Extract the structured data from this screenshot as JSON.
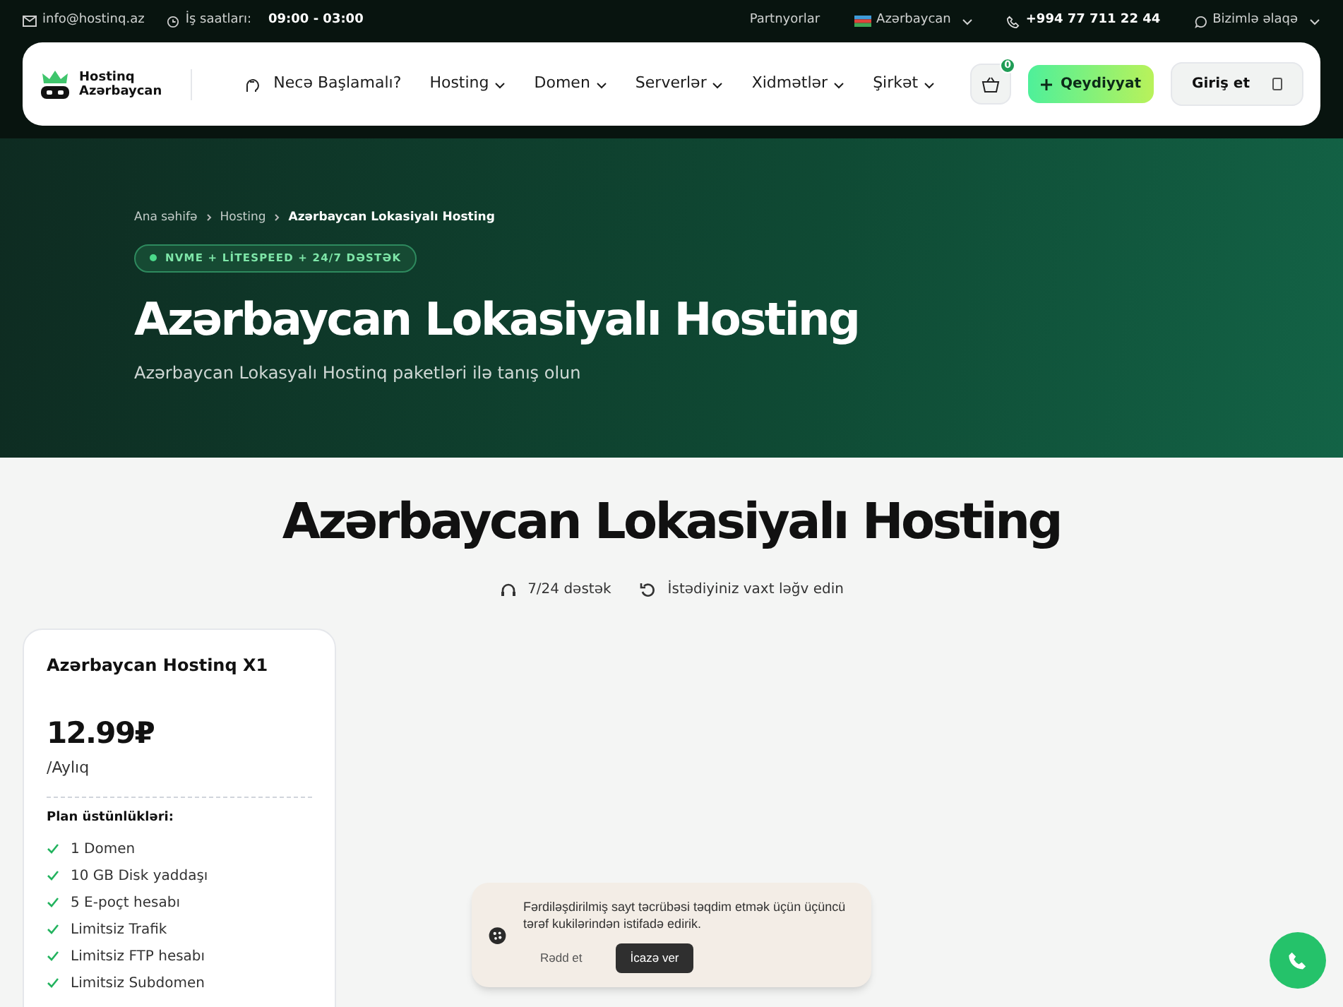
{
  "topbar": {
    "email": "info@hostinq.az",
    "hours_label": "İş saatları:",
    "hours": "09:00 - 03:00",
    "partners": "Partnyorlar",
    "country": "Azərbaycan",
    "phone": "+994 77 711 22 44",
    "contact": "Bizimlə əlaqə"
  },
  "navbar": {
    "logo_line1": "Hostinq",
    "logo_line2": "Azərbaycan",
    "items": [
      {
        "label": "Necə Başlamalı?",
        "kind": "link"
      },
      {
        "label": "Hosting",
        "kind": "dropdown"
      },
      {
        "label": "Domen",
        "kind": "dropdown"
      },
      {
        "label": "Serverlər",
        "kind": "dropdown"
      },
      {
        "label": "Xidmətlər",
        "kind": "dropdown"
      },
      {
        "label": "Şirkət",
        "kind": "dropdown"
      }
    ],
    "cart_count": "0",
    "register": "Qeydiyyat",
    "login": "Giriş et"
  },
  "hero": {
    "breadcrumbs": [
      "Ana səhifə",
      "Hosting",
      "Azərbaycan Lokasiyalı Hosting"
    ],
    "badge": "NVME + LİTESPEED + 24/7 DƏSTƏK",
    "title": "Azərbaycan Lokasiyalı Hosting",
    "subtitle": "Azərbaycan Lokasyalı Hostinq paketləri ilə tanış olun"
  },
  "section": {
    "title": "Azərbaycan Lokasiyalı Hosting",
    "perks": [
      {
        "kind": "support",
        "label": "7/24 dəstək"
      },
      {
        "kind": "cancel",
        "label": "İstədiyiniz vaxt ləğv edin"
      }
    ]
  },
  "plan": {
    "name": "Azərbaycan Hostinq X1",
    "price": "12.99₽",
    "period": "/Aylıq",
    "features_title": "Plan üstünlükləri:",
    "features": [
      "1 Domen",
      "10 GB Disk yaddaşı",
      "5 E-poçt hesabı",
      "Limitsiz Trafik",
      "Limitsiz FTP hesabı",
      "Limitsiz Subdomen"
    ]
  },
  "cookie": {
    "text": "Fərdiləşdirilmiş sayt təcrübəsi təqdim etmək üçün üçüncü tərəf kukilərindən istifadə edirik.",
    "reject": "Rədd et",
    "accept": "İcazə ver"
  }
}
